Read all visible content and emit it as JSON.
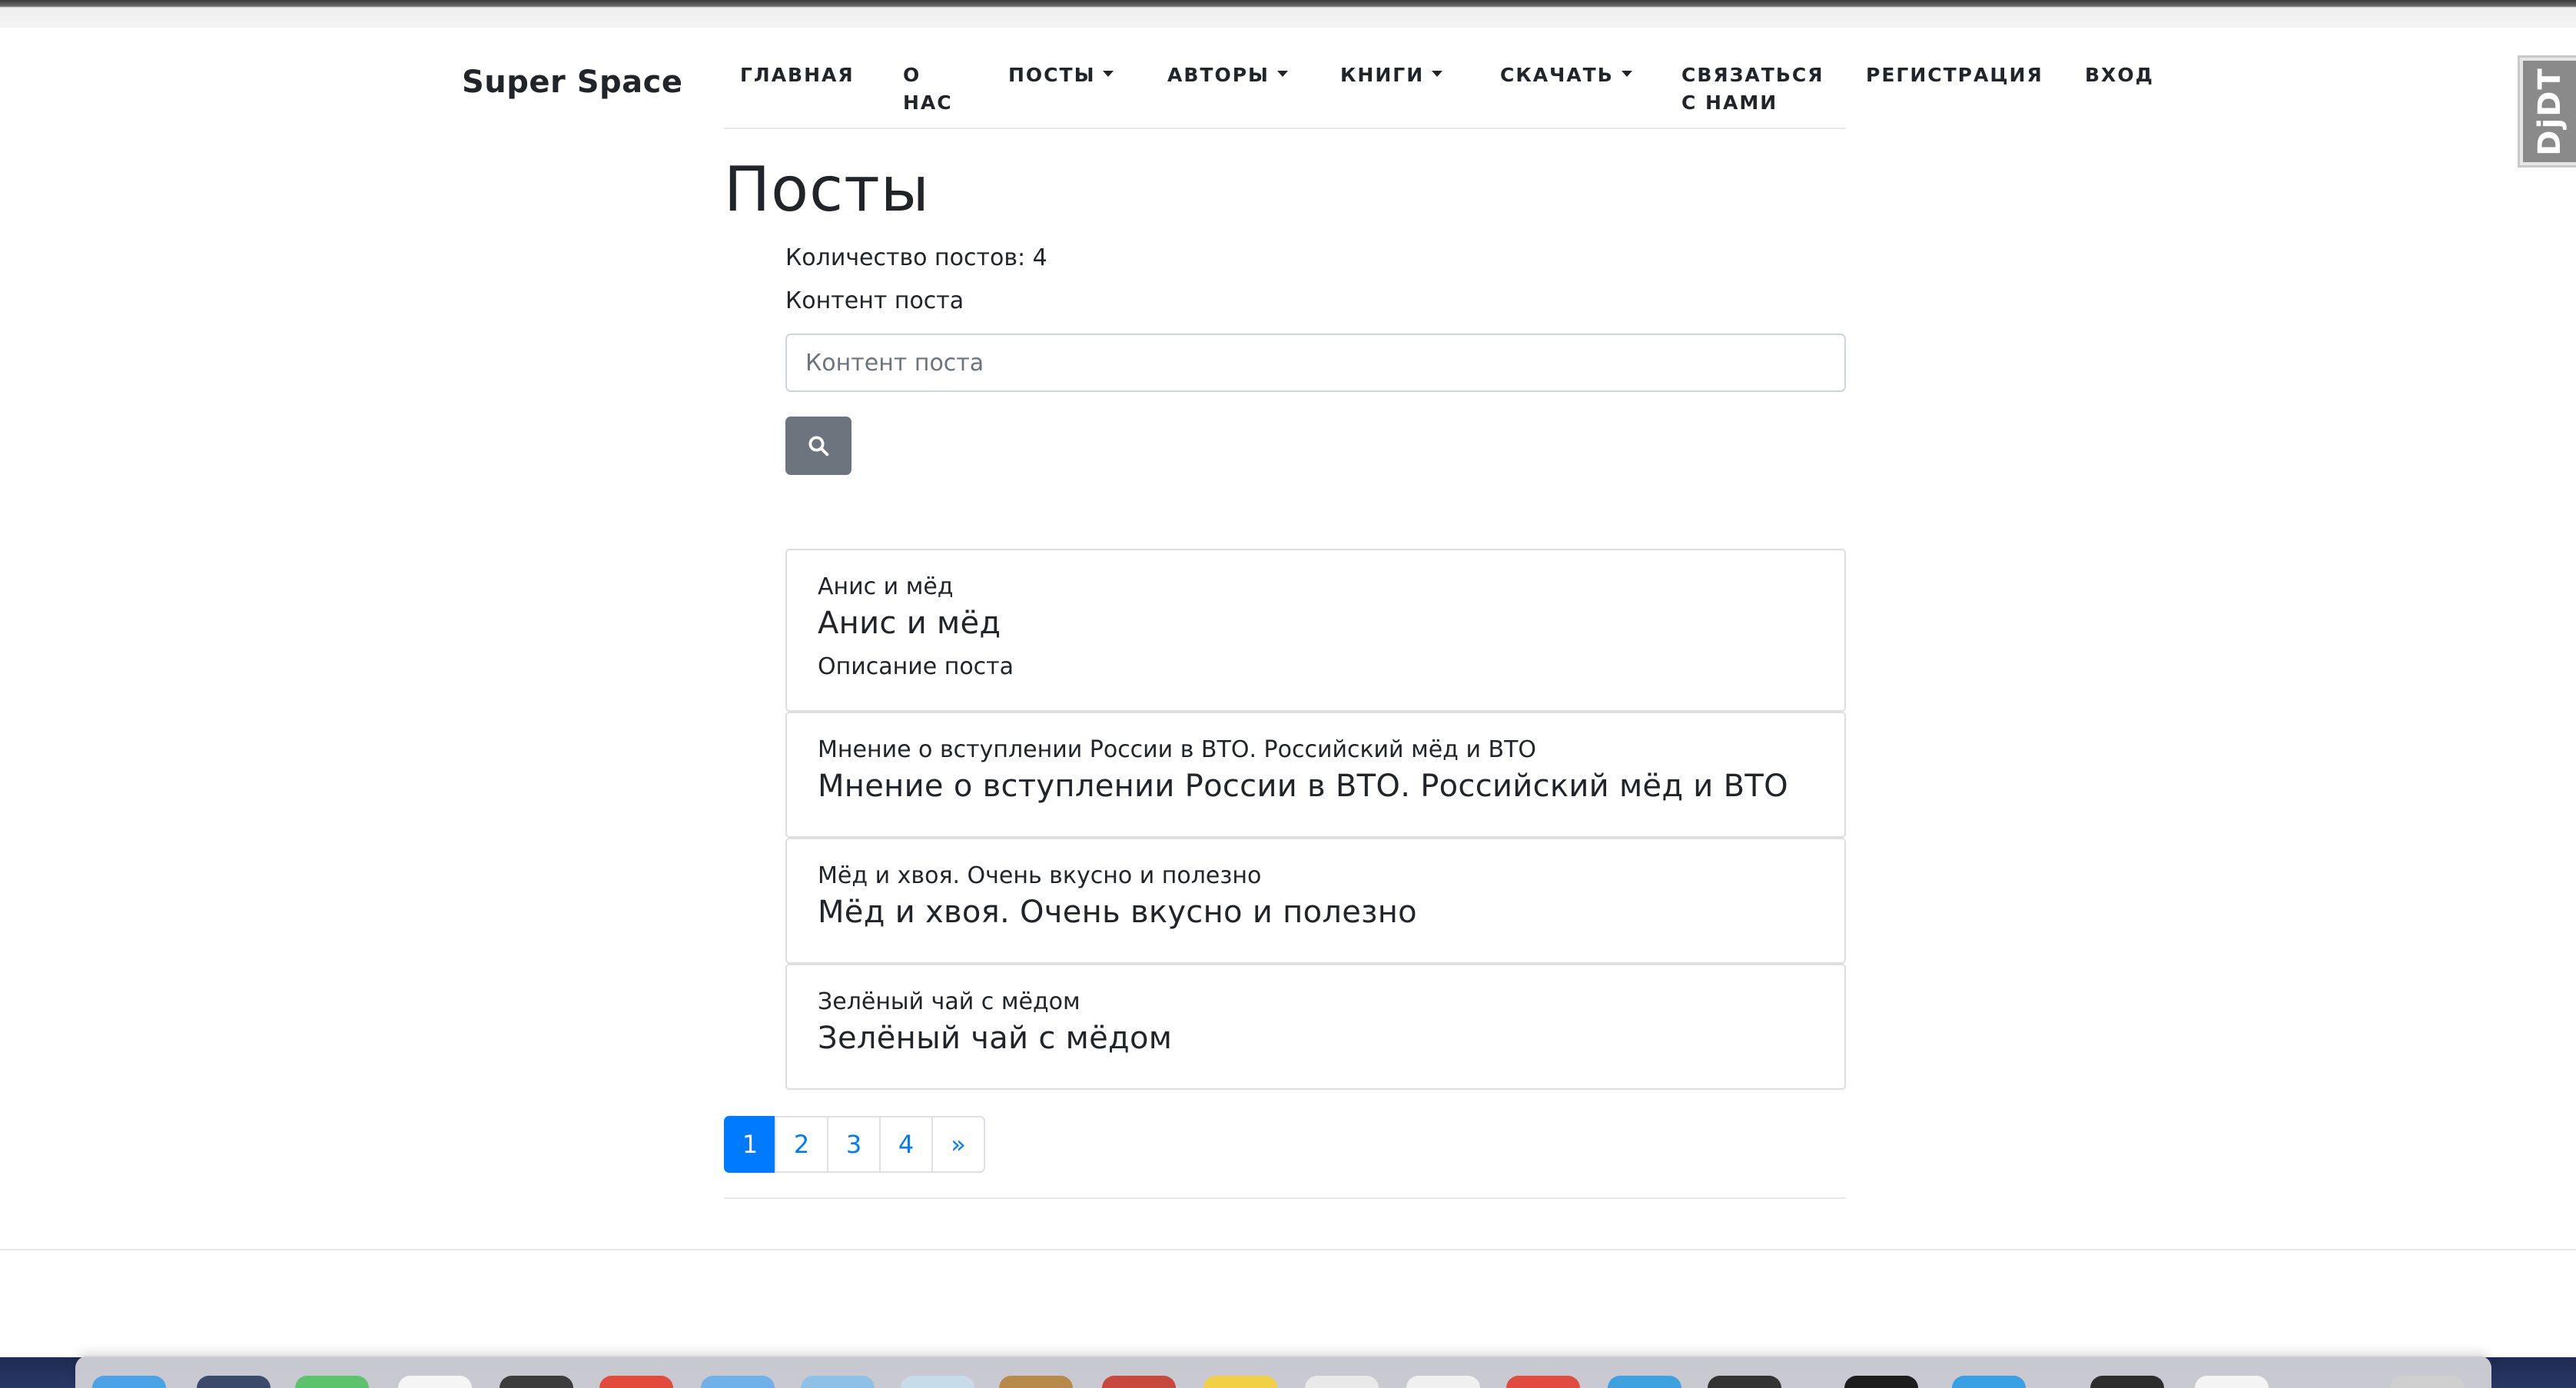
{
  "brand": "Super Space",
  "nav": {
    "home": "ГЛАВНАЯ",
    "about_line1": "О",
    "about_line2": "НАС",
    "posts": "ПОСТЫ",
    "authors": "АВТОРЫ",
    "books": "КНИГИ",
    "download": "СКАЧАТЬ",
    "contact_line1": "СВЯЗАТЬСЯ",
    "contact_line2": "С НАМИ",
    "register": "РЕГИСТРАЦИЯ",
    "login": "ВХОД"
  },
  "debug_toolbar_label": "DjDT",
  "page_title": "Посты",
  "post_count_text": "Количество постов: 4",
  "search": {
    "label": "Контент поста",
    "placeholder": "Контент поста",
    "value": "",
    "button_icon": "search-icon"
  },
  "posts": [
    {
      "small": "Анис и мёд",
      "big": "Анис и мёд",
      "desc": "Описание поста"
    },
    {
      "small": "Мнение о вступлении России в ВТО. Российский мёд и ВТО",
      "big": "Мнение о вступлении России в ВТО. Российский мёд и ВТО"
    },
    {
      "small": "Мёд и хвоя. Очень вкусно и полезно",
      "big": "Мёд и хвоя. Очень вкусно и полезно"
    },
    {
      "small": "Зелёный чай с мёдом",
      "big": "Зелёный чай с мёдом"
    }
  ],
  "pagination": {
    "pages": [
      "1",
      "2",
      "3",
      "4"
    ],
    "active": "1",
    "next": "»"
  },
  "colors": {
    "primary": "#007bff",
    "secondary_button": "#6c757d",
    "text": "#212529"
  }
}
